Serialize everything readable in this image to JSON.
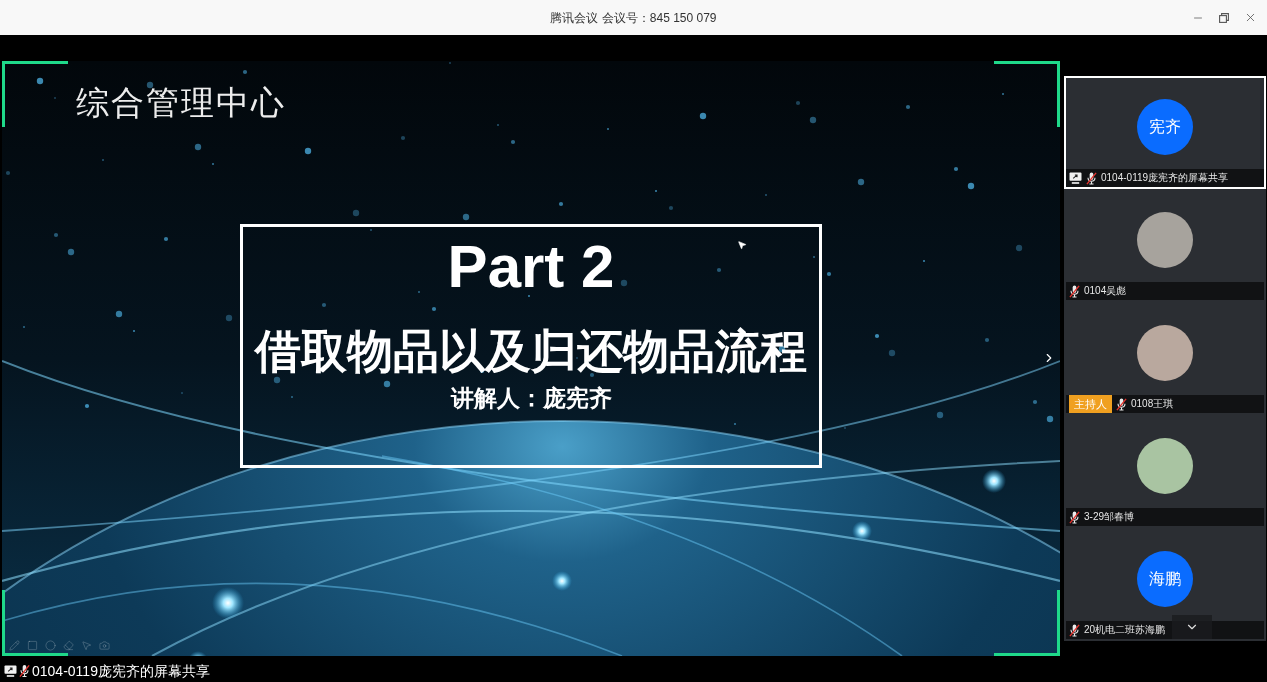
{
  "window": {
    "title": "腾讯会议 会议号：845 150 079"
  },
  "shared_screen": {
    "slide": {
      "header": "综合管理中心",
      "title": "Part 2",
      "subtitle": "借取物品以及归还物品流程",
      "presenter": "讲解人：庞宪齐"
    },
    "caption": {
      "label": "0104-0119庞宪齐的屏幕共享",
      "muted": true
    }
  },
  "participants": [
    {
      "kind": "initials",
      "avatar_text": "宪齐",
      "name": "0104-0119庞宪齐的屏幕共享",
      "sharing": true,
      "muted": true,
      "selected": true
    },
    {
      "kind": "photo",
      "name": "0104吴彪",
      "sharing": false,
      "muted": true,
      "selected": false
    },
    {
      "kind": "photo",
      "badge": "主持人",
      "name": "0108王琪",
      "sharing": false,
      "muted": true,
      "selected": false
    },
    {
      "kind": "photo",
      "name": "3-29邹春博",
      "sharing": false,
      "muted": true,
      "selected": false
    },
    {
      "kind": "initials",
      "avatar_text": "海鹏",
      "name": "20机电二班苏海鹏",
      "sharing": false,
      "muted": true,
      "selected": false
    }
  ]
}
